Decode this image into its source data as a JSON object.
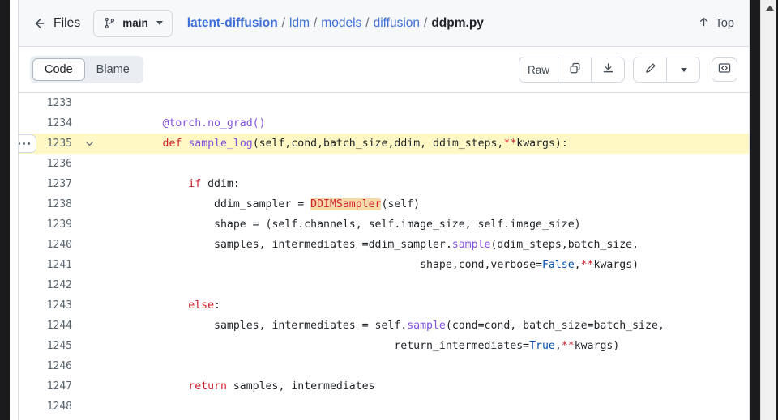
{
  "header": {
    "back_label": "Files",
    "back_icon": "arrow-left-icon",
    "branch": {
      "icon": "git-branch-icon",
      "name": "main",
      "caret_icon": "chevron-down-icon"
    },
    "breadcrumb": {
      "parts": [
        "latent-diffusion",
        "ldm",
        "models",
        "diffusion"
      ],
      "separator": "/",
      "current": "ddpm.py"
    },
    "top_button": {
      "label": "Top",
      "icon": "arrow-up-icon"
    }
  },
  "toolbar": {
    "tabs": [
      {
        "label": "Code",
        "active": true
      },
      {
        "label": "Blame",
        "active": false
      }
    ],
    "raw_label": "Raw",
    "copy_icon": "copy-icon",
    "download_icon": "download-icon",
    "edit_icon": "pencil-icon",
    "edit_caret_icon": "chevron-down-icon",
    "symbols_icon": "code-brackets-icon"
  },
  "code": {
    "highlighted_line": 1235,
    "kebab_icon": "kebab-menu-icon",
    "fold_icon": "chevron-down-icon",
    "lines": [
      {
        "num": "1233",
        "fold": "",
        "tokens": []
      },
      {
        "num": "1234",
        "fold": "",
        "tokens": [
          {
            "t": "        ",
            "c": "tok-plain"
          },
          {
            "t": "@torch.no_grad()",
            "c": "tok-dec"
          }
        ]
      },
      {
        "num": "1235",
        "fold": "chevron",
        "hl": true,
        "tokens": [
          {
            "t": "        ",
            "c": "tok-plain"
          },
          {
            "t": "def",
            "c": "tok-kw"
          },
          {
            "t": " ",
            "c": "tok-plain"
          },
          {
            "t": "sample_log",
            "c": "tok-fn"
          },
          {
            "t": "(self,cond,batch_size,ddim, ddim_steps,",
            "c": "tok-plain"
          },
          {
            "t": "**",
            "c": "tok-op"
          },
          {
            "t": "kwargs):",
            "c": "tok-plain"
          }
        ]
      },
      {
        "num": "1236",
        "fold": "",
        "tokens": []
      },
      {
        "num": "1237",
        "fold": "",
        "tokens": [
          {
            "t": "            ",
            "c": "tok-plain"
          },
          {
            "t": "if",
            "c": "tok-kw"
          },
          {
            "t": " ddim:",
            "c": "tok-plain"
          }
        ]
      },
      {
        "num": "1238",
        "fold": "",
        "tokens": [
          {
            "t": "                ddim_sampler = ",
            "c": "tok-plain"
          },
          {
            "t": "DDIMSampler",
            "c": "tok-mark"
          },
          {
            "t": "(self)",
            "c": "tok-plain"
          }
        ]
      },
      {
        "num": "1239",
        "fold": "",
        "tokens": [
          {
            "t": "                shape = (self.channels, self.image_size, self.image_size)",
            "c": "tok-plain"
          }
        ]
      },
      {
        "num": "1240",
        "fold": "",
        "tokens": [
          {
            "t": "                samples, intermediates =ddim_sampler.",
            "c": "tok-plain"
          },
          {
            "t": "sample",
            "c": "tok-fn"
          },
          {
            "t": "(ddim_steps,batch_size,",
            "c": "tok-plain"
          }
        ]
      },
      {
        "num": "1241",
        "fold": "",
        "tokens": [
          {
            "t": "                                                shape,cond,verbose=",
            "c": "tok-plain"
          },
          {
            "t": "False",
            "c": "tok-const"
          },
          {
            "t": ",",
            "c": "tok-plain"
          },
          {
            "t": "**",
            "c": "tok-op"
          },
          {
            "t": "kwargs)",
            "c": "tok-plain"
          }
        ]
      },
      {
        "num": "1242",
        "fold": "",
        "tokens": []
      },
      {
        "num": "1243",
        "fold": "",
        "tokens": [
          {
            "t": "            ",
            "c": "tok-plain"
          },
          {
            "t": "else",
            "c": "tok-kw"
          },
          {
            "t": ":",
            "c": "tok-plain"
          }
        ]
      },
      {
        "num": "1244",
        "fold": "",
        "tokens": [
          {
            "t": "                samples, intermediates = self.",
            "c": "tok-plain"
          },
          {
            "t": "sample",
            "c": "tok-fn"
          },
          {
            "t": "(cond=cond, batch_size=batch_size,",
            "c": "tok-plain"
          }
        ]
      },
      {
        "num": "1245",
        "fold": "",
        "tokens": [
          {
            "t": "                                            return_intermediates=",
            "c": "tok-plain"
          },
          {
            "t": "True",
            "c": "tok-const"
          },
          {
            "t": ",",
            "c": "tok-plain"
          },
          {
            "t": "**",
            "c": "tok-op"
          },
          {
            "t": "kwargs)",
            "c": "tok-plain"
          }
        ]
      },
      {
        "num": "1246",
        "fold": "",
        "tokens": []
      },
      {
        "num": "1247",
        "fold": "",
        "tokens": [
          {
            "t": "            ",
            "c": "tok-plain"
          },
          {
            "t": "return",
            "c": "tok-kw"
          },
          {
            "t": " samples, intermediates",
            "c": "tok-plain"
          }
        ]
      },
      {
        "num": "1248",
        "fold": "",
        "tokens": []
      }
    ]
  },
  "scrollbar": {
    "up_arrow_icon": "scroll-up-arrow-icon"
  },
  "colors": {
    "highlight_line": "#fff8c5",
    "symbol_highlight": "#f5d9a8",
    "link": "#3f6fd8",
    "keyword": "#cf222e",
    "function": "#8250df",
    "constant": "#0550ae",
    "border": "#d8dee4",
    "header_bg": "#f6f8fa"
  }
}
